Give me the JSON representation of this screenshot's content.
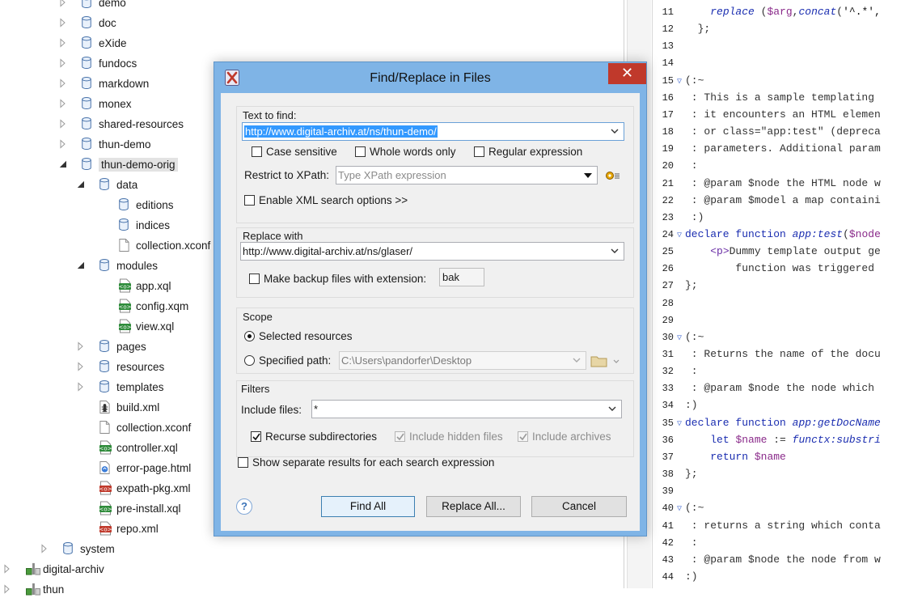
{
  "tree": {
    "items": [
      {
        "label": "demo",
        "icon": "collection",
        "level": 1,
        "state": "collapsed"
      },
      {
        "label": "doc",
        "icon": "collection",
        "level": 1,
        "state": "collapsed"
      },
      {
        "label": "eXide",
        "icon": "collection",
        "level": 1,
        "state": "collapsed"
      },
      {
        "label": "fundocs",
        "icon": "collection",
        "level": 1,
        "state": "collapsed"
      },
      {
        "label": "markdown",
        "icon": "collection",
        "level": 1,
        "state": "collapsed"
      },
      {
        "label": "monex",
        "icon": "collection",
        "level": 1,
        "state": "collapsed"
      },
      {
        "label": "shared-resources",
        "icon": "collection",
        "level": 1,
        "state": "collapsed"
      },
      {
        "label": "thun-demo",
        "icon": "collection",
        "level": 1,
        "state": "collapsed"
      },
      {
        "label": "thun-demo-orig",
        "icon": "collection",
        "level": 1,
        "state": "expanded",
        "selected": true
      },
      {
        "label": "data",
        "icon": "collection",
        "level": 2,
        "state": "expanded"
      },
      {
        "label": "editions",
        "icon": "collection",
        "level": 3,
        "state": "none"
      },
      {
        "label": "indices",
        "icon": "collection",
        "level": 3,
        "state": "none"
      },
      {
        "label": "collection.xconf",
        "icon": "file",
        "level": 3,
        "state": "none"
      },
      {
        "label": "modules",
        "icon": "collection",
        "level": 2,
        "state": "expanded"
      },
      {
        "label": "app.xql",
        "icon": "xquery",
        "level": 3,
        "state": "none"
      },
      {
        "label": "config.xqm",
        "icon": "xquery",
        "level": 3,
        "state": "none"
      },
      {
        "label": "view.xql",
        "icon": "xquery",
        "level": 3,
        "state": "none"
      },
      {
        "label": "pages",
        "icon": "collection",
        "level": 2,
        "state": "collapsed"
      },
      {
        "label": "resources",
        "icon": "collection",
        "level": 2,
        "state": "collapsed"
      },
      {
        "label": "templates",
        "icon": "collection",
        "level": 2,
        "state": "collapsed"
      },
      {
        "label": "build.xml",
        "icon": "ant",
        "level": 2,
        "state": "none"
      },
      {
        "label": "collection.xconf",
        "icon": "file",
        "level": 2,
        "state": "none"
      },
      {
        "label": "controller.xql",
        "icon": "xquery",
        "level": 2,
        "state": "none"
      },
      {
        "label": "error-page.html",
        "icon": "html",
        "level": 2,
        "state": "none"
      },
      {
        "label": "expath-pkg.xml",
        "icon": "xml",
        "level": 2,
        "state": "none"
      },
      {
        "label": "pre-install.xql",
        "icon": "xquery",
        "level": 2,
        "state": "none"
      },
      {
        "label": "repo.xml",
        "icon": "xml",
        "level": 2,
        "state": "none"
      },
      {
        "label": "system",
        "icon": "collection",
        "level": 0,
        "state": "collapsed"
      },
      {
        "label": "digital-archiv",
        "icon": "server",
        "level": -1,
        "state": "collapsed"
      },
      {
        "label": "thun",
        "icon": "server",
        "level": -1,
        "state": "collapsed"
      }
    ]
  },
  "editor": {
    "lines": [
      {
        "n": "11",
        "fold": false,
        "html": "    <span class='c-fn'>replace</span> (<span class='c-var'>$arg</span>,<span class='c-fn'>concat</span>(<span class='c-str'>'^.*',</span>"
      },
      {
        "n": "12",
        "fold": false,
        "html": "  };"
      },
      {
        "n": "13",
        "fold": false,
        "html": ""
      },
      {
        "n": "14",
        "fold": false,
        "html": ""
      },
      {
        "n": "15",
        "fold": true,
        "html": "(:~"
      },
      {
        "n": "16",
        "fold": false,
        "html": " : This is a sample templating"
      },
      {
        "n": "17",
        "fold": false,
        "html": " : it encounters an HTML elemen"
      },
      {
        "n": "18",
        "fold": false,
        "html": " : or class=\"app:test\" (depreca"
      },
      {
        "n": "19",
        "fold": false,
        "html": " : parameters. Additional param"
      },
      {
        "n": "20",
        "fold": false,
        "html": " :"
      },
      {
        "n": "21",
        "fold": false,
        "html": " : @param $node the HTML node w"
      },
      {
        "n": "22",
        "fold": false,
        "html": " : @param $model a map containi"
      },
      {
        "n": "23",
        "fold": false,
        "html": " :)"
      },
      {
        "n": "24",
        "fold": true,
        "html": "<span class='c-kw'>declare function</span> <span class='c-fn'>app:test</span>(<span class='c-var'>$node</span>"
      },
      {
        "n": "25",
        "fold": false,
        "html": "    <span class='c-tag'>&lt;p&gt;</span>Dummy template output ge"
      },
      {
        "n": "26",
        "fold": false,
        "html": "        function was triggered"
      },
      {
        "n": "27",
        "fold": false,
        "html": "};"
      },
      {
        "n": "28",
        "fold": false,
        "html": ""
      },
      {
        "n": "29",
        "fold": false,
        "html": ""
      },
      {
        "n": "30",
        "fold": true,
        "html": "(:~"
      },
      {
        "n": "31",
        "fold": false,
        "html": " : Returns the name of the docu"
      },
      {
        "n": "32",
        "fold": false,
        "html": " :"
      },
      {
        "n": "33",
        "fold": false,
        "html": " : @param $node the node which"
      },
      {
        "n": "34",
        "fold": false,
        "html": ":)"
      },
      {
        "n": "35",
        "fold": true,
        "html": "<span class='c-kw'>declare function</span> <span class='c-fn'>app:getDocName</span>"
      },
      {
        "n": "36",
        "fold": false,
        "html": "    <span class='c-kw'>let</span> <span class='c-var'>$name</span> := <span class='c-fn'>functx:substri</span>"
      },
      {
        "n": "37",
        "fold": false,
        "html": "    <span class='c-kw'>return</span> <span class='c-var'>$name</span>"
      },
      {
        "n": "38",
        "fold": false,
        "html": "};"
      },
      {
        "n": "39",
        "fold": false,
        "html": ""
      },
      {
        "n": "40",
        "fold": true,
        "html": "(:~"
      },
      {
        "n": "41",
        "fold": false,
        "html": " : returns a string which conta"
      },
      {
        "n": "42",
        "fold": false,
        "html": " :"
      },
      {
        "n": "43",
        "fold": false,
        "html": " : @param $node the node from w"
      },
      {
        "n": "44",
        "fold": false,
        "html": ":)"
      }
    ]
  },
  "dialog": {
    "title": "Find/Replace in Files",
    "close_glyph": "✕",
    "find_group": {
      "label": "Text to find:",
      "value": "http://www.digital-archiv.at/ns/thun-demo/",
      "case_sensitive": "Case sensitive",
      "whole_words": "Whole words only",
      "regex": "Regular expression",
      "restrict_label": "Restrict to XPath:",
      "restrict_placeholder": "Type XPath expression",
      "xml_options": "Enable XML search options >>"
    },
    "replace_group": {
      "label": "Replace with",
      "value": "http://www.digital-archiv.at/ns/glaser/",
      "backup_label": "Make backup files with extension:",
      "backup_ext": "bak"
    },
    "scope_group": {
      "label": "Scope",
      "selected_resources": "Selected resources",
      "specified_path": "Specified path:",
      "path_value": "C:\\Users\\pandorfer\\Desktop"
    },
    "filters_group": {
      "label": "Filters",
      "include_label": "Include files:",
      "include_value": "*",
      "recurse": "Recurse subdirectories",
      "hidden": "Include hidden files",
      "archives": "Include archives"
    },
    "separate_results": "Show separate results for each search expression",
    "help_glyph": "?",
    "buttons": {
      "find_all": "Find All",
      "replace_all": "Replace All...",
      "cancel": "Cancel"
    }
  }
}
